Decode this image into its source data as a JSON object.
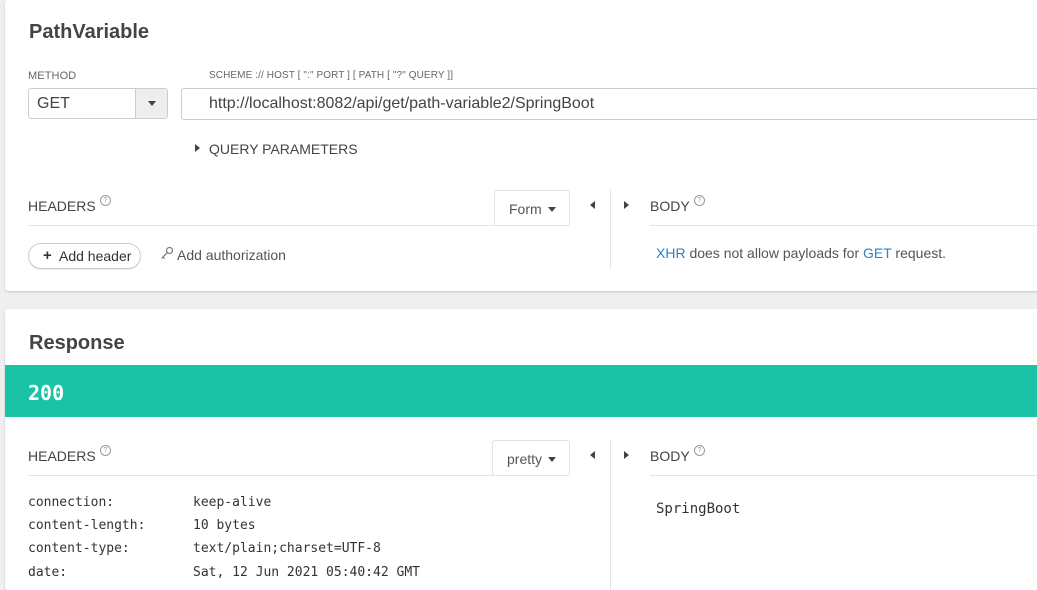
{
  "request": {
    "title": "PathVariable",
    "method_label": "METHOD",
    "method_value": "GET",
    "url_label": "SCHEME :// HOST [ \":\" PORT ] [ PATH [ \"?\" QUERY ]]",
    "url_value": "http://localhost:8082/api/get/path-variable2/SpringBoot",
    "query_parameters_label": "QUERY PARAMETERS",
    "headers_label": "HEADERS",
    "headers_mode": "Form",
    "body_label": "BODY",
    "add_header_label": "Add header",
    "add_authorization_label": "Add authorization",
    "body_note": {
      "xhr": "XHR",
      "middle": " does not allow payloads for ",
      "method": "GET",
      "end": " request."
    }
  },
  "response": {
    "title": "Response",
    "status_code": "200",
    "status_color": "#1bc3a6",
    "headers_label": "HEADERS",
    "headers_mode": "pretty",
    "body_label": "BODY",
    "headers": [
      {
        "name": "connection:",
        "value": "keep-alive"
      },
      {
        "name": "content-length:",
        "value": "10 bytes"
      },
      {
        "name": "content-type:",
        "value": "text/plain;charset=UTF-8"
      },
      {
        "name": "date:",
        "value": "Sat, 12 Jun 2021 05:40:42 GMT"
      }
    ],
    "body": "SpringBoot"
  },
  "icons": {
    "help": "question-circle-icon",
    "collapse": "caret-left-icon",
    "expand": "caret-right-icon",
    "key": "key-icon",
    "plus": "plus-icon"
  },
  "colors": {
    "link": "#2a82c9",
    "success": "#1bc3a6"
  }
}
